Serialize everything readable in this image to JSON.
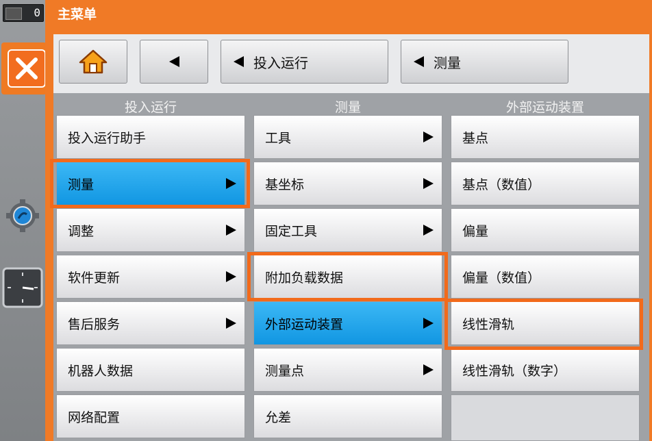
{
  "status": {
    "value": "0"
  },
  "title": "主菜单",
  "nav": {
    "back_label": "",
    "crumbs": [
      {
        "label": "投入运行"
      },
      {
        "label": "测量"
      }
    ]
  },
  "columns": [
    {
      "header": "投入运行",
      "items": [
        {
          "label": "投入运行助手",
          "arrow": false,
          "selected": false
        },
        {
          "label": "测量",
          "arrow": true,
          "selected": true
        },
        {
          "label": "调整",
          "arrow": true,
          "selected": false
        },
        {
          "label": "软件更新",
          "arrow": true,
          "selected": false
        },
        {
          "label": "售后服务",
          "arrow": true,
          "selected": false
        },
        {
          "label": "机器人数据",
          "arrow": false,
          "selected": false
        },
        {
          "label": "网络配置",
          "arrow": false,
          "selected": false
        }
      ]
    },
    {
      "header": "测量",
      "items": [
        {
          "label": "工具",
          "arrow": true,
          "selected": false
        },
        {
          "label": "基坐标",
          "arrow": true,
          "selected": false
        },
        {
          "label": "固定工具",
          "arrow": true,
          "selected": false
        },
        {
          "label": "附加负载数据",
          "arrow": false,
          "selected": false
        },
        {
          "label": "外部运动装置",
          "arrow": true,
          "selected": true
        },
        {
          "label": "测量点",
          "arrow": true,
          "selected": false
        },
        {
          "label": "允差",
          "arrow": false,
          "selected": false
        }
      ]
    },
    {
      "header": "外部运动装置",
      "items": [
        {
          "label": "基点",
          "arrow": false,
          "selected": false
        },
        {
          "label": "基点（数值）",
          "arrow": false,
          "selected": false
        },
        {
          "label": "偏量",
          "arrow": false,
          "selected": false
        },
        {
          "label": "偏量（数值）",
          "arrow": false,
          "selected": false
        },
        {
          "label": "线性滑轨",
          "arrow": false,
          "selected": false
        },
        {
          "label": "线性滑轨（数字）",
          "arrow": false,
          "selected": false
        }
      ]
    }
  ],
  "colors": {
    "accent": "#f07a26",
    "highlight": "#f26a1b",
    "selected": "#1ea7ef"
  }
}
